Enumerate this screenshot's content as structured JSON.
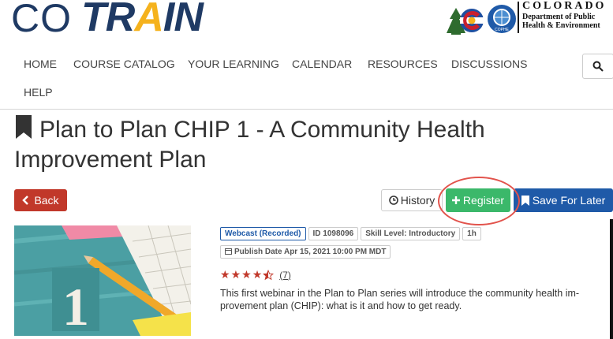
{
  "brand": {
    "logo_co": "CO",
    "logo_train_pre": "TR",
    "logo_train_a": "A",
    "logo_train_post": "IN",
    "state_name": "COLORADO",
    "state_dept_line1": "Department of Public",
    "state_dept_line2": "Health & Environment",
    "badge_text": "COPHE"
  },
  "nav": {
    "items": [
      "HOME",
      "COURSE CATALOG",
      "YOUR LEARNING",
      "CALENDAR",
      "RESOURCES",
      "DISCUSSIONS"
    ],
    "help": "HELP"
  },
  "course": {
    "title": "Plan to Plan CHIP 1 - A Community Health Improvement Plan",
    "tags": {
      "format": "Webcast (Recorded)",
      "id": "ID 1098096",
      "skill": "Skill Level: Introductory",
      "duration": "1h",
      "publish": "Publish Date Apr 15, 2021 10:00 PM MDT"
    },
    "rating": 4.5,
    "rating_count": "(7)",
    "description": "This first webinar in the Plan to Plan series will introduce the community health im-provement plan (CHIP): what is it and how to get ready.",
    "thumbnail_numeral": "1"
  },
  "actions": {
    "back": "Back",
    "history": "History",
    "register": "Register",
    "save": "Save For Later"
  },
  "colors": {
    "brand_navy": "#1f3a64",
    "brand_gold": "#f5b21d",
    "back_red": "#c1382a",
    "register_green": "#3bb86a",
    "save_blue": "#1f5aa8",
    "annotation": "#e2534c"
  }
}
